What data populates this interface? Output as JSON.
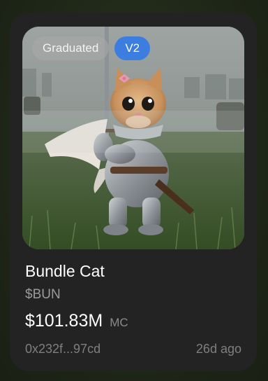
{
  "token": {
    "badges": {
      "status": "Graduated",
      "version": "V2"
    },
    "name": "Bundle Cat",
    "ticker": "$BUN",
    "market_cap": "$101.83M",
    "market_cap_label": "MC",
    "address": "0x232f...97cd",
    "age": "26d ago"
  },
  "colors": {
    "card_background": "#232323",
    "page_background": "#1f2718",
    "version_badge": "#3c7de0",
    "muted_text": "#9b9b9b"
  }
}
